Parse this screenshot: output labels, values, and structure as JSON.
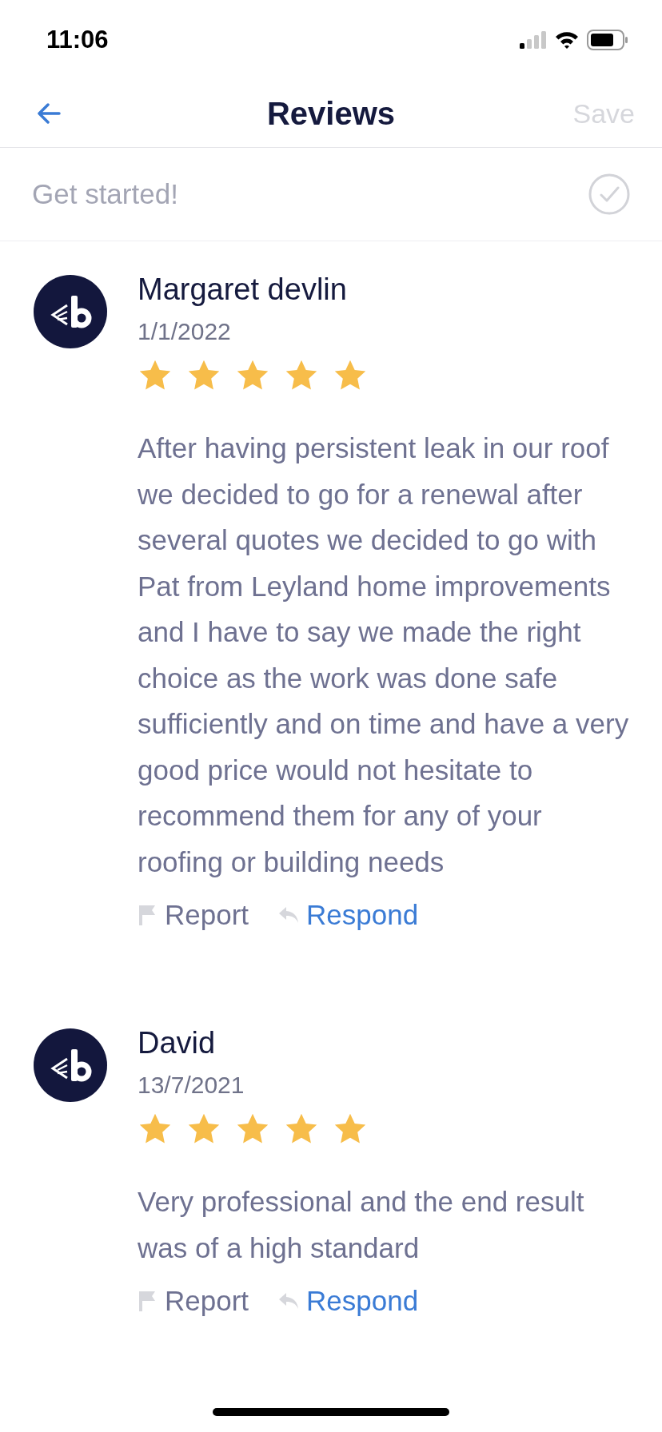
{
  "status_bar": {
    "time": "11:06"
  },
  "nav": {
    "title": "Reviews",
    "save": {
      "label": "Save",
      "disabled": true
    }
  },
  "banner": {
    "label": "Get started!"
  },
  "reviews": [
    {
      "name": "Margaret devlin",
      "date": "1/1/2022",
      "stars": 5,
      "text": "After having persistent leak in our roof we decided to go for a renewal after several quotes we decided to go with Pat from Leyland home improvements and I have to say we made the right choice as the work was done safe sufficiently and on time and have a very good price would not hesitate to recommend them for any of your roofing or building needs",
      "report": "Report",
      "respond": "Respond"
    },
    {
      "name": "David",
      "date": "13/7/2021",
      "stars": 5,
      "text": "Very professional and the end result was of a high standard",
      "report": "Report",
      "respond": "Respond"
    }
  ]
}
